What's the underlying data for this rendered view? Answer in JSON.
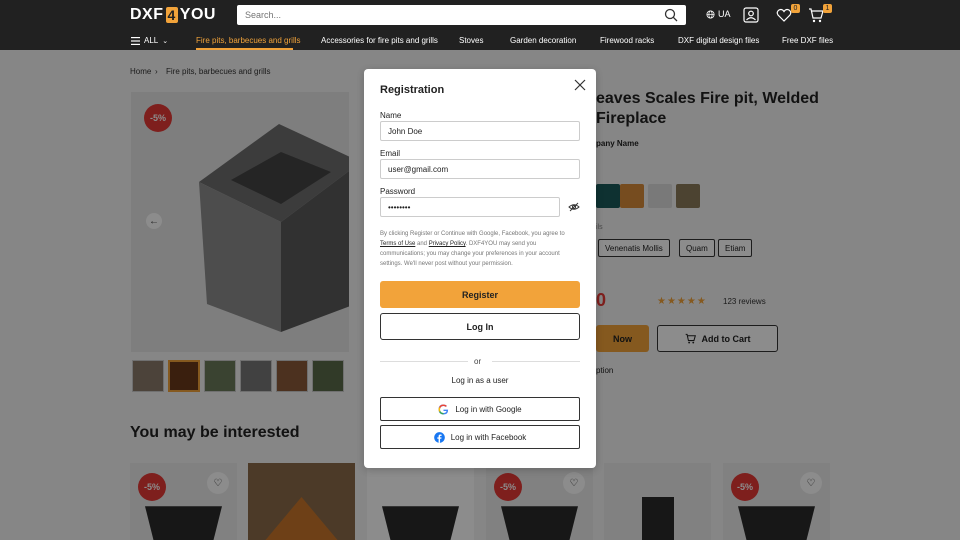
{
  "header": {
    "logo": {
      "part1": "DXF",
      "part2": "4",
      "part3": "YOU"
    },
    "search_placeholder": "Search...",
    "language": "UA",
    "wishlist_count": "0",
    "cart_count": "1"
  },
  "nav": {
    "all_label": "ALL",
    "items": [
      "Fire pits, barbecues and grills",
      "Accessories for fire pits and grills",
      "Stoves",
      "Garden decoration",
      "Firewood racks",
      "DXF digital design files",
      "Free DXF files"
    ]
  },
  "breadcrumb": {
    "home": "Home",
    "category": "Fire pits, barbecues and grills"
  },
  "product": {
    "discount": "-5%",
    "title_line1": "eaves Scales Fire pit, Welded",
    "title_line2": "Fireplace",
    "company": "pany Name",
    "variants_label": "ils",
    "chips": [
      "Venenatis Mollis",
      "Quam",
      "Etiam"
    ],
    "price": "0",
    "stars": "★★★★★",
    "reviews": "123 reviews",
    "buy_label": "Now",
    "cart_label": "Add to Cart",
    "option_text": "ption"
  },
  "recommend": {
    "title": "You may be interested",
    "discount": "-5%"
  },
  "modal": {
    "title": "Registration",
    "name_label": "Name",
    "name_value": "John Doe",
    "email_label": "Email",
    "email_value": "user@gmail.com",
    "password_label": "Password",
    "password_value": "••••••••",
    "legal_pre": "By clicking Register or Continue with Google, Facebook, you agree to ",
    "terms": "Terms of Use",
    "and": " and ",
    "privacy": "Privacy Policy",
    "legal_post": ". DXF4YOU may send you communications; you may change your preferences in your account settings. We'll never post without your permission.",
    "register_label": "Register",
    "login_label": "Log In",
    "or_label": "or",
    "user_login": "Log in as a user",
    "google_label": "Log in with Google",
    "facebook_label": "Log in with Facebook"
  },
  "colors": {
    "accent": "#f2a33a",
    "header_bg": "#212121",
    "sale_red": "#e53935",
    "google_blue": "#4285f4",
    "facebook_blue": "#1877f2"
  }
}
